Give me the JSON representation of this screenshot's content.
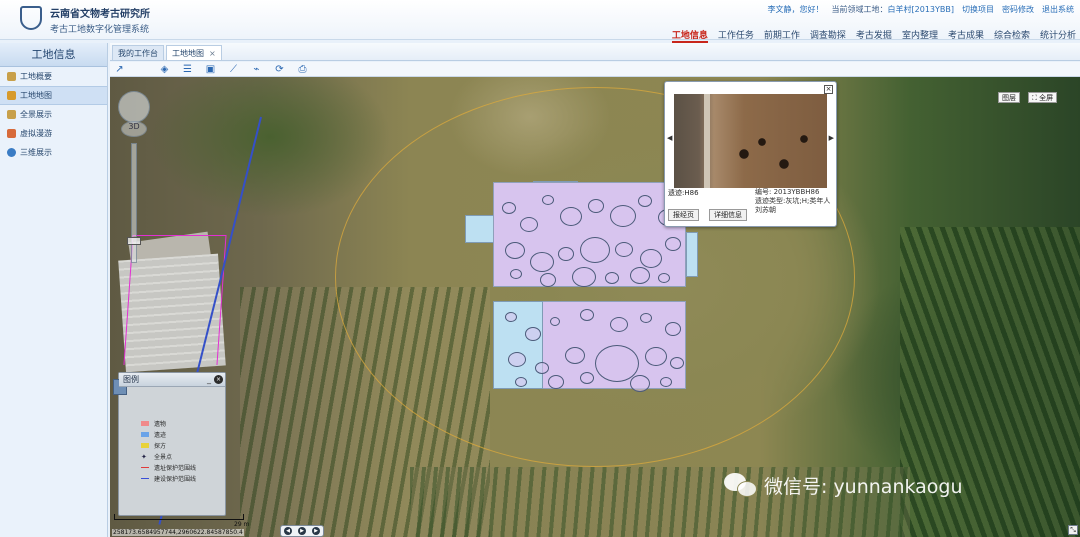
{
  "header": {
    "logo_line1": "云南省文物考古研究所",
    "logo_line2": "考古工地数字化管理系统",
    "user_greeting": "李文静，您好！",
    "current_site_label": "当前领域工地：",
    "current_site": "白羊村[2013YBB]",
    "switch_project": "切换项目",
    "change_password": "密码修改",
    "logout": "退出系统"
  },
  "nav": {
    "items": [
      "工地信息",
      "工作任务",
      "前期工作",
      "调查勘探",
      "考古发掘",
      "室内整理",
      "考古成果",
      "综合检索",
      "统计分析"
    ],
    "active_index": 0
  },
  "sidebar": {
    "title": "工地信息",
    "items": [
      {
        "label": "工地概要",
        "icon": "folder-icon",
        "color": "#c8a04a"
      },
      {
        "label": "工地地图",
        "icon": "map-icon",
        "color": "#d79a2b"
      },
      {
        "label": "全景展示",
        "icon": "panorama-icon",
        "color": "#c8a04a"
      },
      {
        "label": "虚拟漫游",
        "icon": "tour-icon",
        "color": "#d76a3a"
      },
      {
        "label": "三维展示",
        "icon": "globe-icon",
        "color": "#3a7cc4"
      }
    ],
    "active_index": 1
  },
  "tabs": {
    "items": [
      "我的工作台",
      "工地地图"
    ],
    "close_glyph": "×",
    "active_index": 1
  },
  "popup": {
    "code_label": "遗迹:H86",
    "number": "编号: 2013YBBH86",
    "type": "遗迹类型:灰坑;H;类年人",
    "owner": "刘苏朝",
    "btn_locate": "报经页",
    "btn_detail": "详细信息",
    "close": "×",
    "prev": "◀",
    "next": "▶"
  },
  "map": {
    "btn_layers": "图层",
    "btn_fullscreen": "全屏",
    "compass_label": "3D",
    "scale_label": "29 m",
    "coords": "258173.6584957744,2960622.84587850.4",
    "resize_glyph": "⤡"
  },
  "legend": {
    "title": "图例",
    "minimize": "_",
    "close": "×",
    "items": [
      {
        "label": "遗物",
        "kind": "swatch",
        "color": "#f08a8a"
      },
      {
        "label": "遗迹",
        "kind": "swatch",
        "color": "#6aa3e8"
      },
      {
        "label": "探方",
        "kind": "swatch",
        "color": "#e8d23a"
      },
      {
        "label": "全景点",
        "kind": "pin",
        "color": "#222244"
      },
      {
        "label": "遗址保护范围线",
        "kind": "line",
        "color": "#e03a3a"
      },
      {
        "label": "建设保护范围线",
        "kind": "line",
        "color": "#3a4fd8"
      }
    ]
  },
  "pager": [
    "◀",
    "▶",
    "▶"
  ],
  "watermark": "微信号: yunnankaogu",
  "colors": {
    "accent": "#c8261b",
    "nav_text": "#2c4a70",
    "excavation_fill": "#d7c4ee",
    "excavation_blue": "#bde0f2"
  }
}
